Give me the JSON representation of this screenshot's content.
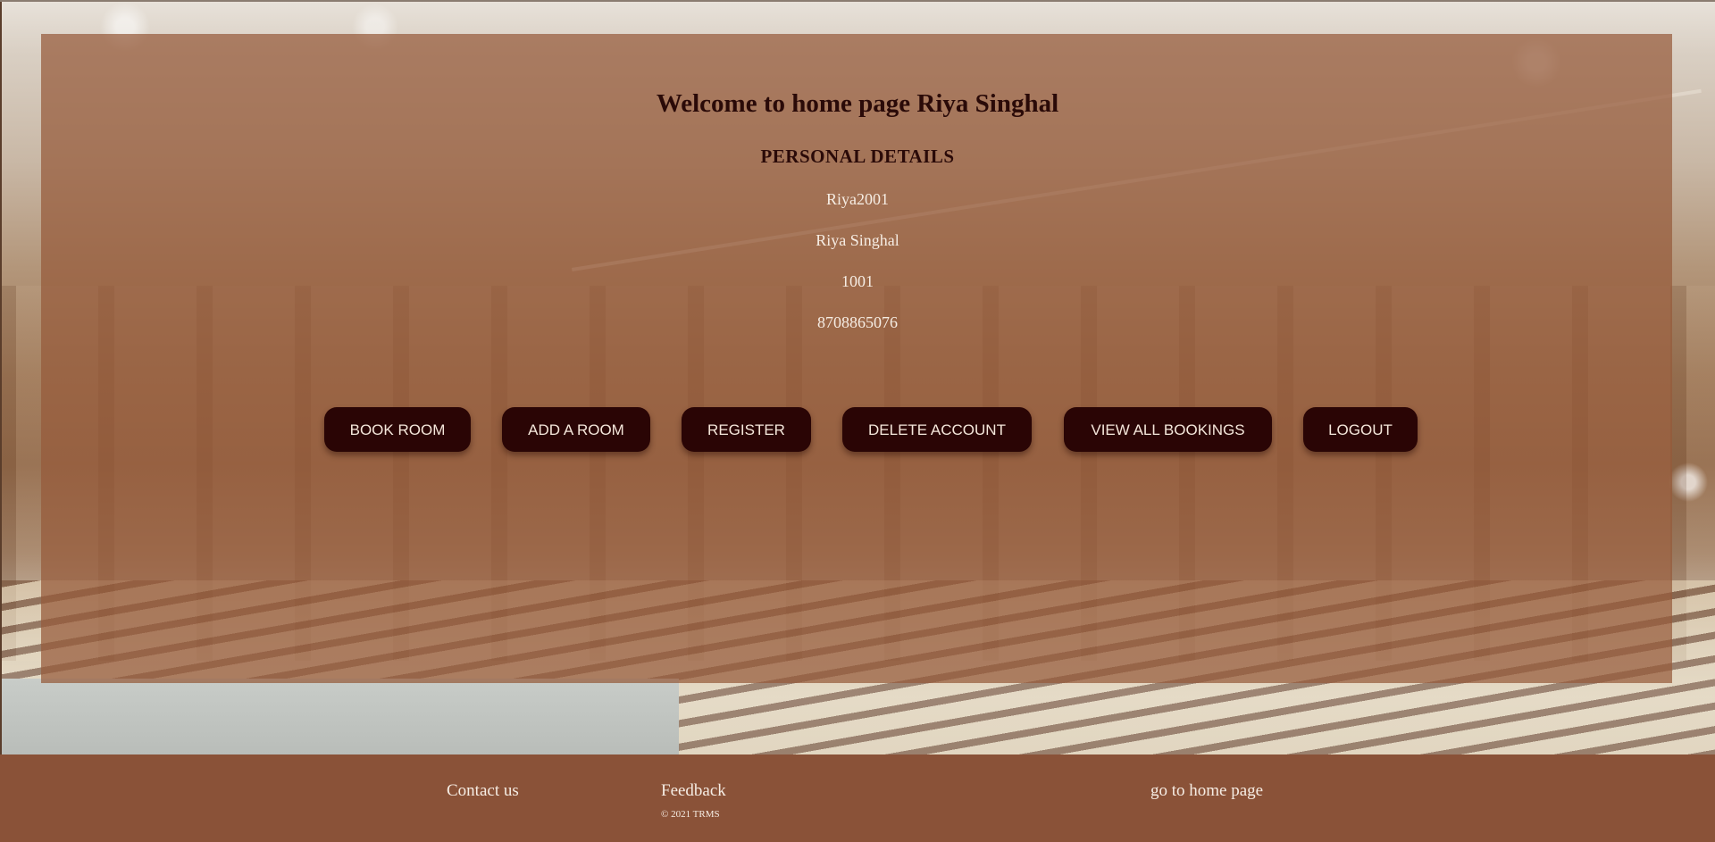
{
  "main": {
    "welcome_title": "Welcome to home page Riya Singhal",
    "section_heading": "PERSONAL DETAILS",
    "details": {
      "username": "Riya2001",
      "full_name": "Riya Singhal",
      "id": "1001",
      "phone": "8708865076"
    }
  },
  "actions": {
    "book_room": "BOOK ROOM",
    "add_room": "ADD A ROOM",
    "register": "REGISTER",
    "delete_account": "DELETE ACCOUNT",
    "view_all_bookings": "VIEW ALL BOOKINGS",
    "logout": "LOGOUT"
  },
  "footer": {
    "contact": "Contact us",
    "feedback": "Feedback",
    "copyright": "© 2021 TRMS",
    "home_link": "go to home page"
  },
  "colors": {
    "overlay": "#965a3a",
    "button_bg": "#2a0505",
    "footer_bg": "#8a5238",
    "heading_text": "#2a0a08",
    "light_text": "#f6ede4"
  }
}
